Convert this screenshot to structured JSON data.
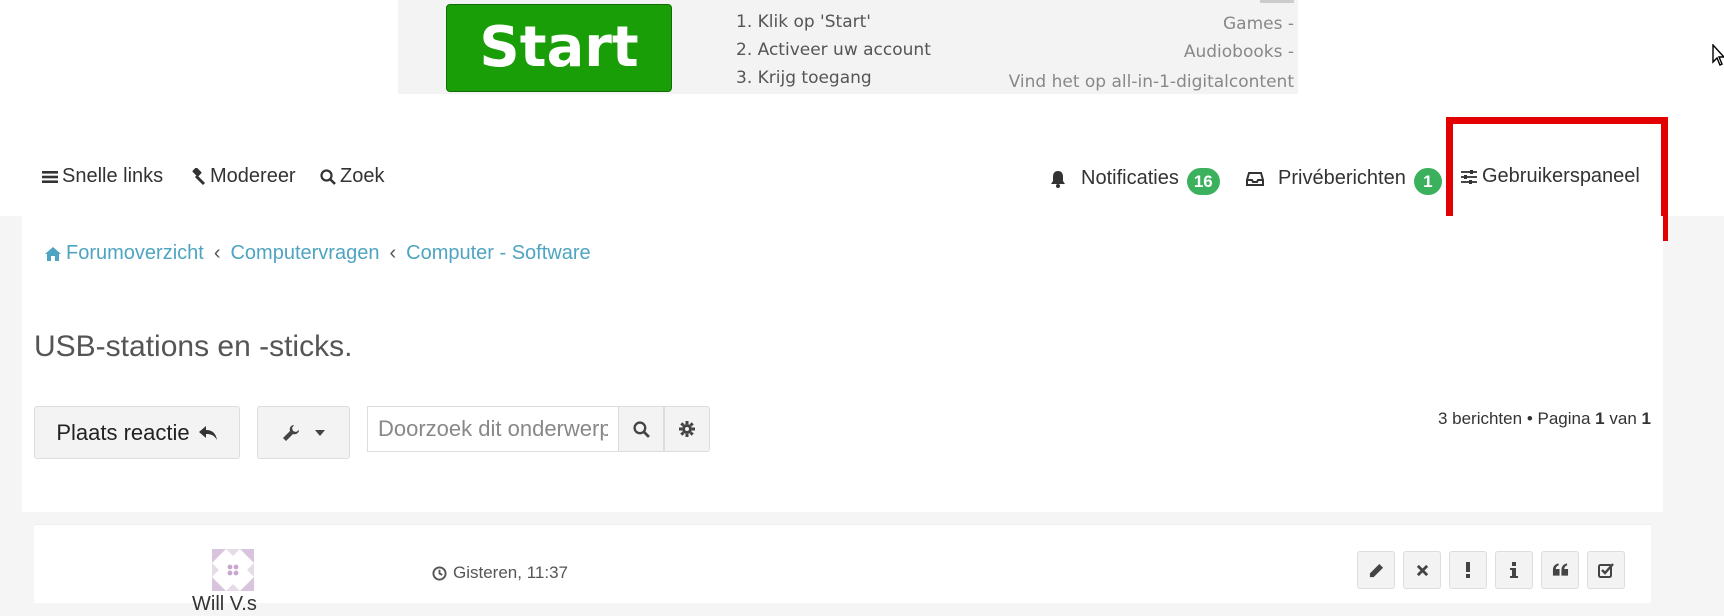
{
  "ad": {
    "start_label": "Start",
    "steps": [
      "1. Klik op 'Start'",
      "2. Activeer uw account",
      "3. Krijg toegang"
    ],
    "right_lines": [
      "Games -",
      "Audiobooks -",
      "Vind het op all-in-1-digitalcontent"
    ]
  },
  "navbar": {
    "quick_links": "Snelle links",
    "moderate": "Modereer",
    "search": "Zoek",
    "notifications": "Notificaties",
    "notifications_count": "16",
    "messages": "Privéberichten",
    "messages_count": "1",
    "user_panel": "Gebruikerspaneel"
  },
  "breadcrumb": {
    "items": [
      "Forumoverzicht",
      "Computervragen",
      "Computer - Software"
    ]
  },
  "topic": {
    "title": "USB-stations en -sticks."
  },
  "actions": {
    "reply_label": "Plaats reactie",
    "search_placeholder": "Doorzoek dit onderwerp"
  },
  "pagination": {
    "posts": "3 berichten",
    "separator": "•",
    "page_label": "Pagina",
    "current": "1",
    "of_label": "van",
    "total": "1"
  },
  "post": {
    "author": "Will V.s",
    "time": "Gisteren, 11:37",
    "buttons": [
      "edit-icon",
      "delete-icon",
      "report-icon",
      "info-icon",
      "quote-icon",
      "approve-icon"
    ]
  },
  "colors": {
    "accent_link": "#4fa4c2",
    "badge": "#3cb15d",
    "highlight": "#e30000",
    "ad_start": "#1a9e08"
  }
}
